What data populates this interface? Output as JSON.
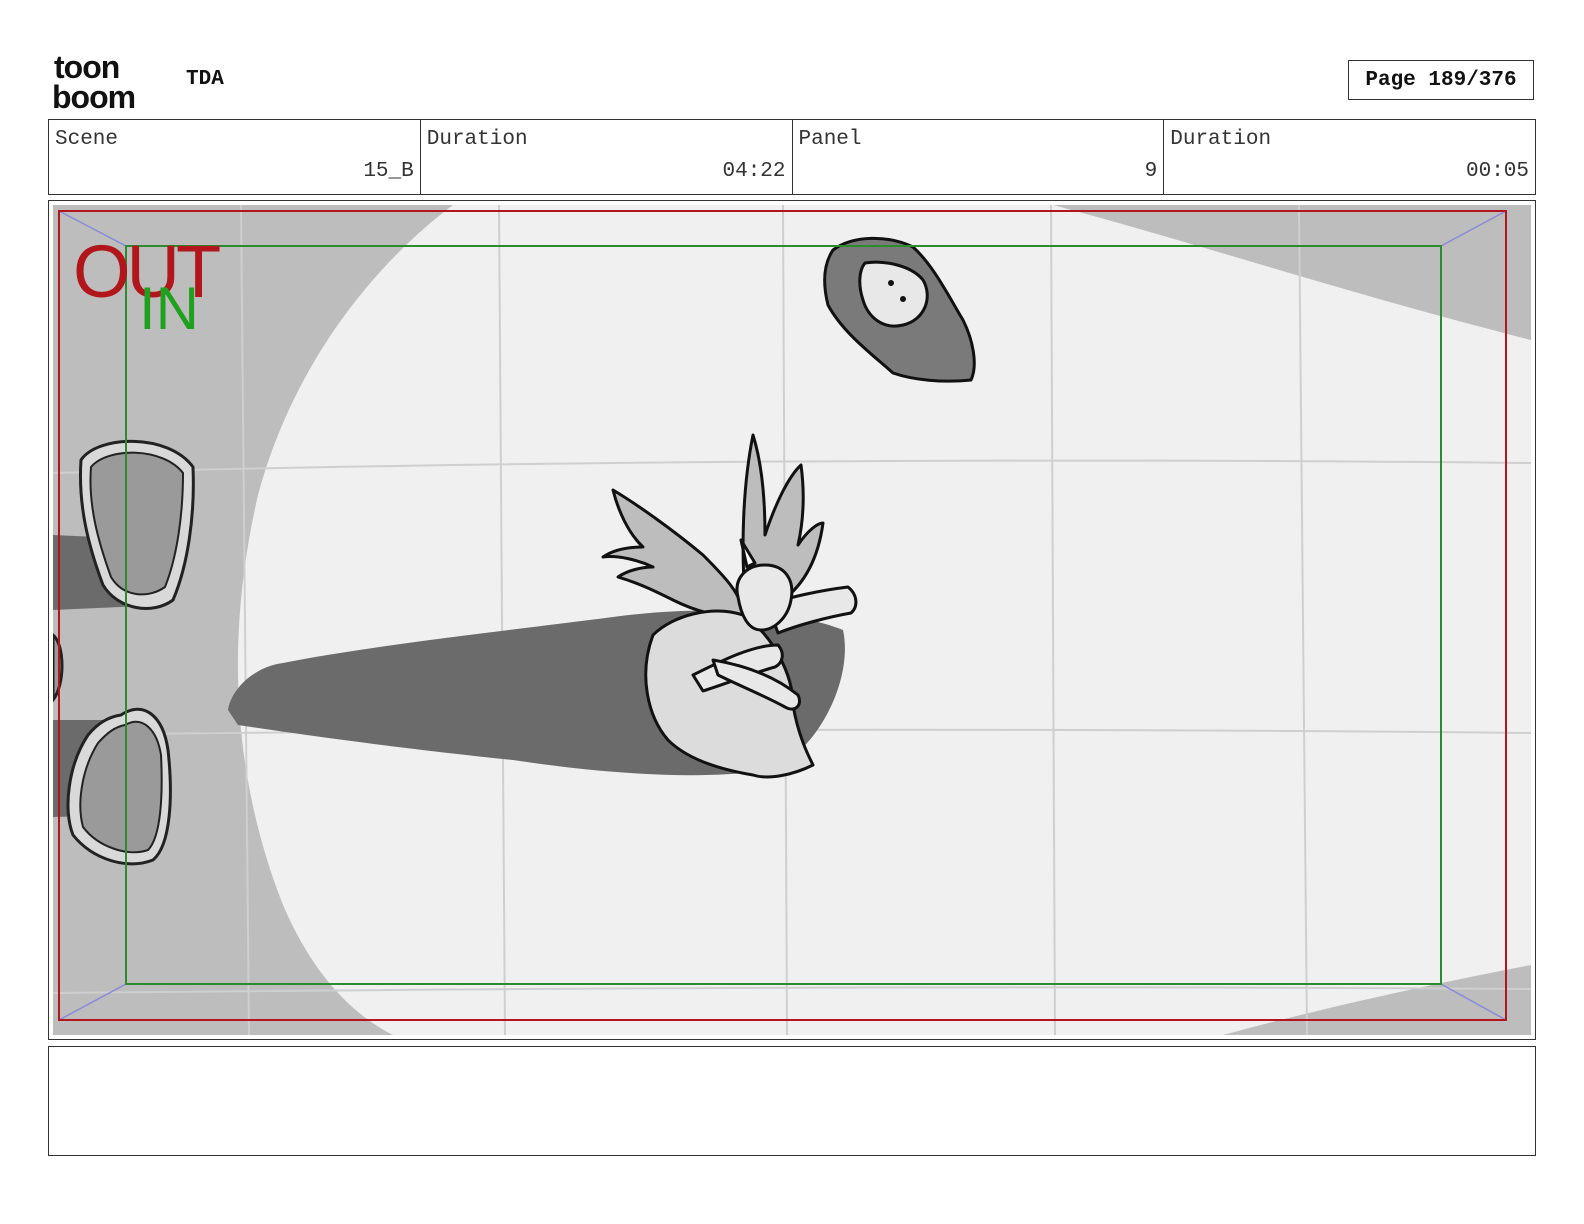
{
  "header": {
    "logo_line1": "toon",
    "logo_line2": "boom",
    "project": "TDA",
    "page_label": "Page 189/376"
  },
  "info": {
    "scene_label": "Scene",
    "scene_value": "15_B",
    "scene_duration_label": "Duration",
    "scene_duration_value": "04:22",
    "panel_label": "Panel",
    "panel_value": "9",
    "panel_duration_label": "Duration",
    "panel_duration_value": "00:05"
  },
  "panel": {
    "out_label": "OUT",
    "in_label": "IN",
    "colors": {
      "out_frame": "#b0161b",
      "in_frame": "#2e8a2e",
      "in_text": "#1fa01f",
      "shadow_dark": "#6b6b6b",
      "shadow_mid": "#bdbdbd",
      "floor_light": "#f0f0f0"
    }
  },
  "notes": {
    "text": ""
  }
}
